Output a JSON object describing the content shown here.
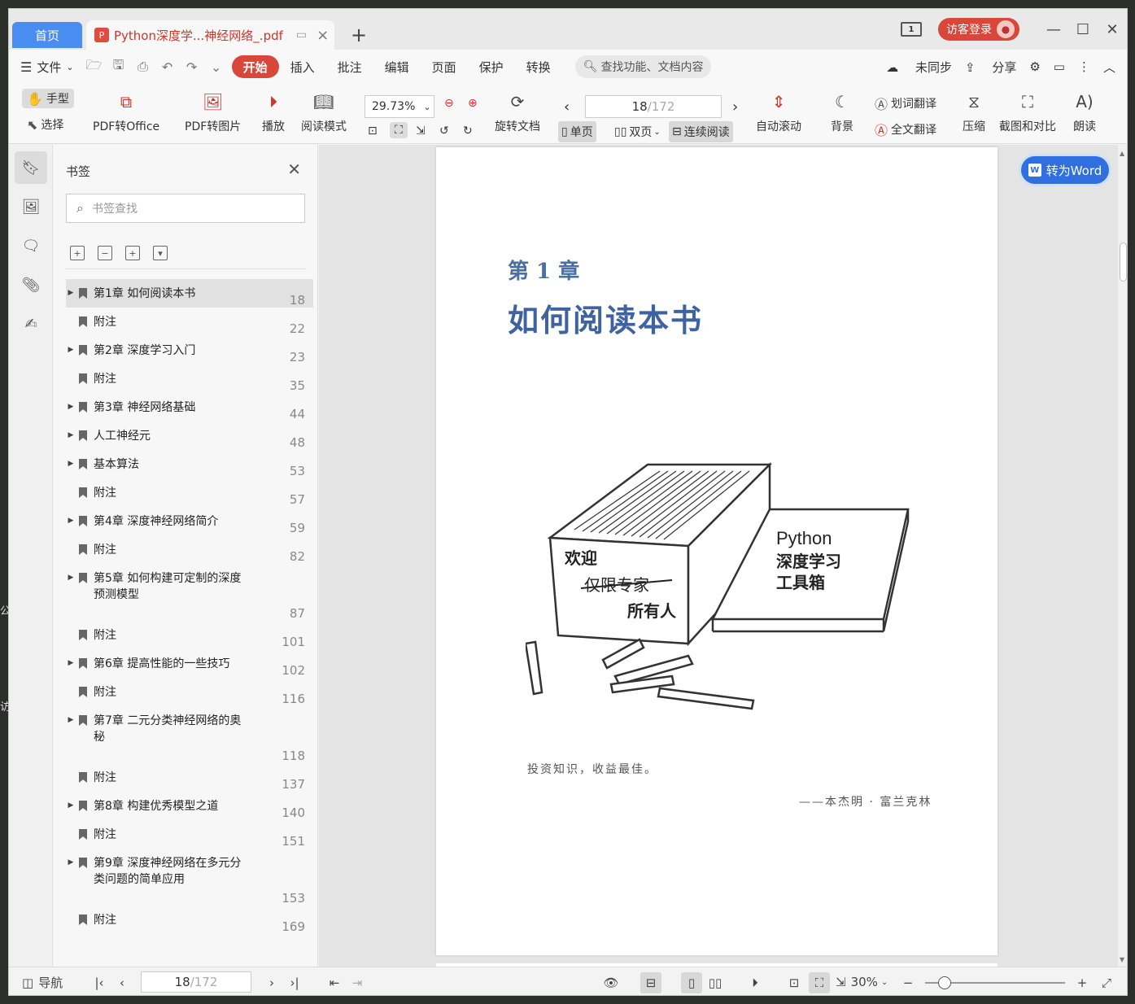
{
  "titlebar": {
    "home_tab": "首页",
    "doc_tab": "Python深度学...神经网络_.pdf",
    "page_count_badge": "1",
    "login_label": "访客登录"
  },
  "menu": {
    "file_label": "文件",
    "tabs": [
      "开始",
      "插入",
      "批注",
      "编辑",
      "页面",
      "保护",
      "转换"
    ],
    "active_tab": "开始",
    "search_placeholder": "查找功能、文档内容",
    "sync_label": "未同步",
    "share_label": "分享"
  },
  "ribbon": {
    "hand_label": "手型",
    "select_label": "选择",
    "pdf_to_office": "PDF转Office",
    "pdf_to_image": "PDF转图片",
    "play": "播放",
    "read_mode": "阅读模式",
    "zoom_value": "29.73%",
    "rotate_doc": "旋转文档",
    "page_current": "18",
    "page_total": "/172",
    "single_page": "单页",
    "double_page": "双页",
    "continuous": "连续阅读",
    "auto_scroll": "自动滚动",
    "background": "背景",
    "word_translate": "划词翻译",
    "full_translate": "全文翻译",
    "compress": "压缩",
    "screenshot_compare": "截图和对比",
    "read_aloud": "朗读"
  },
  "bookmarks": {
    "title": "书签",
    "search_placeholder": "书签查找",
    "items": [
      {
        "label": "第1章 如何阅读本书",
        "page": "18",
        "expandable": true,
        "selected": true
      },
      {
        "label": "附注",
        "page": "22",
        "expandable": false
      },
      {
        "label": "第2章 深度学习入门",
        "page": "23",
        "expandable": true
      },
      {
        "label": "附注",
        "page": "35",
        "expandable": false
      },
      {
        "label": "第3章 神经网络基础",
        "page": "44",
        "expandable": true
      },
      {
        "label": "人工神经元",
        "page": "48",
        "expandable": true
      },
      {
        "label": "基本算法",
        "page": "53",
        "expandable": true
      },
      {
        "label": "附注",
        "page": "57",
        "expandable": false
      },
      {
        "label": "第4章 深度神经网络简介",
        "page": "59",
        "expandable": true
      },
      {
        "label": "附注",
        "page": "82",
        "expandable": false
      },
      {
        "label": "第5章 如何构建可定制的深度预测模型",
        "page": "87",
        "expandable": true
      },
      {
        "label": "附注",
        "page": "101",
        "expandable": false
      },
      {
        "label": "第6章 提高性能的一些技巧",
        "page": "102",
        "expandable": true
      },
      {
        "label": "附注",
        "page": "116",
        "expandable": false
      },
      {
        "label": "第7章 二元分类神经网络的奥秘",
        "page": "118",
        "expandable": true
      },
      {
        "label": "附注",
        "page": "137",
        "expandable": false
      },
      {
        "label": "第8章 构建优秀模型之道",
        "page": "140",
        "expandable": true
      },
      {
        "label": "附注",
        "page": "151",
        "expandable": false
      },
      {
        "label": "第9章 深度神经网络在多元分类问题的简单应用",
        "page": "153",
        "expandable": true
      },
      {
        "label": "附注",
        "page": "169",
        "expandable": false
      }
    ]
  },
  "document": {
    "chapter_number": "第 1 章",
    "chapter_title": "如何阅读本书",
    "box_label_1": "欢迎",
    "box_label_2": "仅限专家",
    "box_label_3": "所有人",
    "book_line_1": "Python",
    "book_line_2": "深度学习",
    "book_line_3": "工具箱",
    "quote": "投资知识，收益最佳。",
    "author": "——本杰明 · 富兰克林",
    "to_word": "转为Word"
  },
  "statusbar": {
    "nav_label": "导航",
    "page_current": "18",
    "page_total": "/172",
    "zoom": "30%"
  },
  "colors": {
    "accent_red": "#d9473b",
    "home_tab_blue": "#4a8df0",
    "to_word_blue": "#2f6fe0",
    "chapter_blue": "#3f63a0"
  }
}
